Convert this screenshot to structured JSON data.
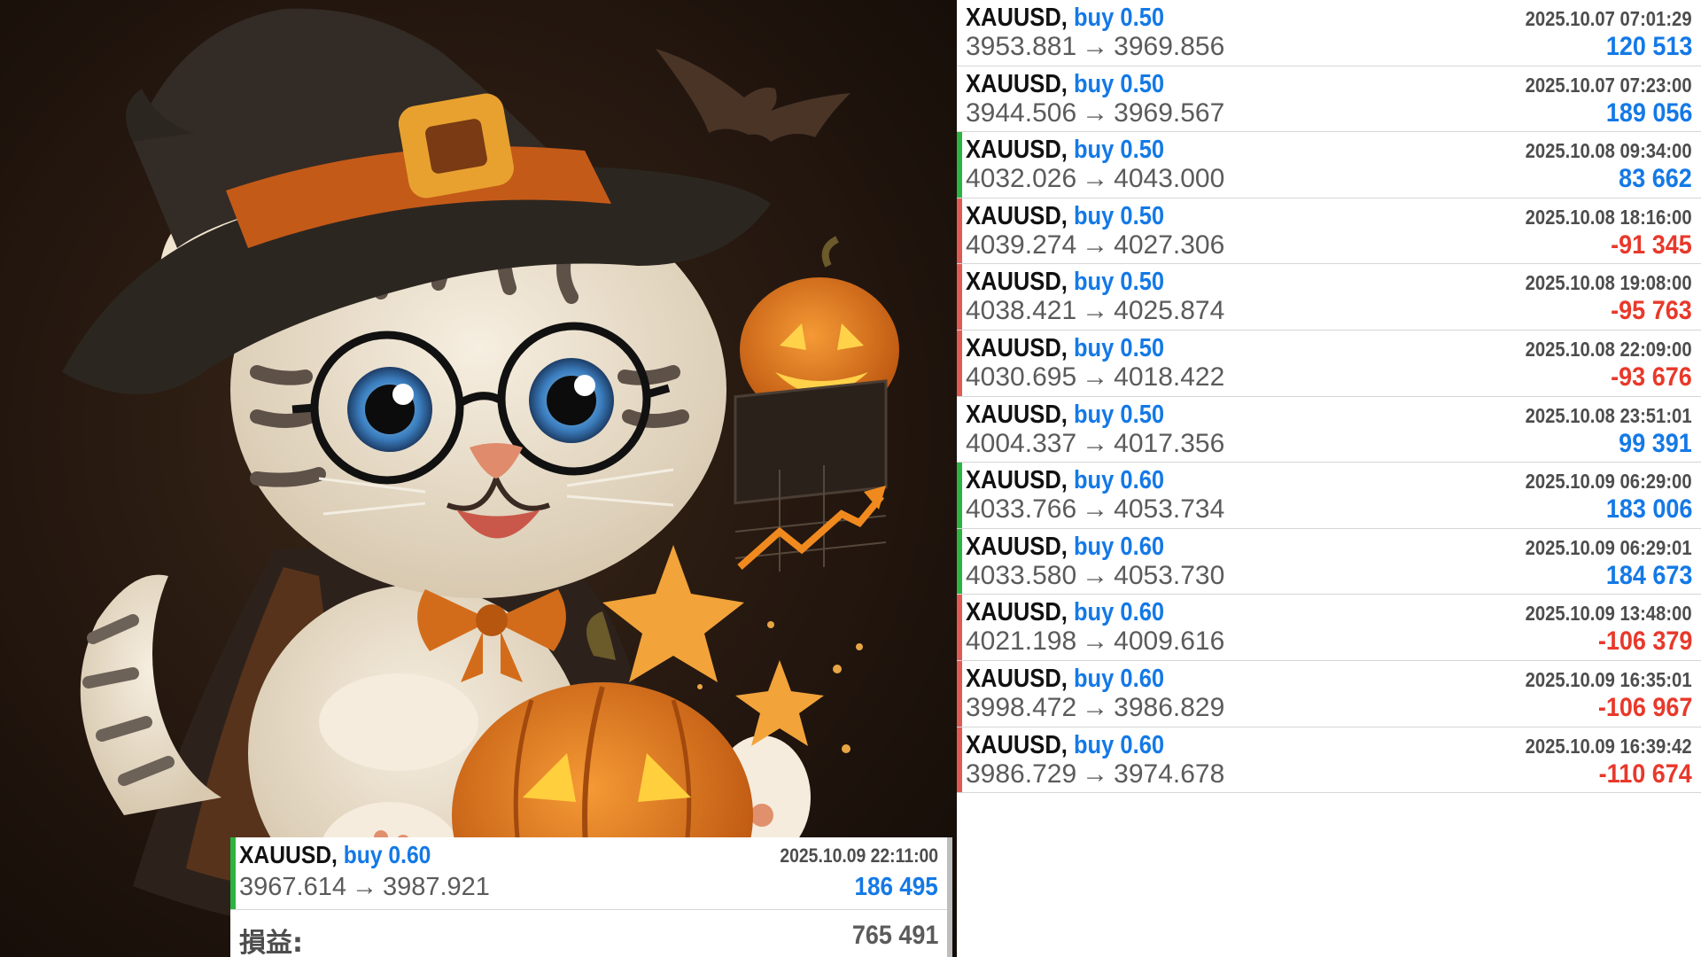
{
  "colors": {
    "buy_text": "#1479e6",
    "profit": "#1479e6",
    "loss": "#e8392b",
    "profit_bar": "#2db341",
    "loss_bar": "#e05a54"
  },
  "illustration": {
    "subject": "kitten-in-witch-hat",
    "icons": [
      "witch-hat-icon",
      "bat-icon",
      "jack-o-lantern-icon",
      "star-icon",
      "chart-arrow-icon"
    ]
  },
  "trades": [
    {
      "symbol": "XAUUSD,",
      "side": "buy 0.50",
      "time": "2025.10.07 07:01:29",
      "open": "3953.881",
      "close": "3969.856",
      "profit": "120 513",
      "result": "none"
    },
    {
      "symbol": "XAUUSD,",
      "side": "buy 0.50",
      "time": "2025.10.07 07:23:00",
      "open": "3944.506",
      "close": "3969.567",
      "profit": "189 056",
      "result": "none"
    },
    {
      "symbol": "XAUUSD,",
      "side": "buy 0.50",
      "time": "2025.10.08 09:34:00",
      "open": "4032.026",
      "close": "4043.000",
      "profit": "83 662",
      "result": "profit"
    },
    {
      "symbol": "XAUUSD,",
      "side": "buy 0.50",
      "time": "2025.10.08 18:16:00",
      "open": "4039.274",
      "close": "4027.306",
      "profit": "-91 345",
      "result": "loss"
    },
    {
      "symbol": "XAUUSD,",
      "side": "buy 0.50",
      "time": "2025.10.08 19:08:00",
      "open": "4038.421",
      "close": "4025.874",
      "profit": "-95 763",
      "result": "loss"
    },
    {
      "symbol": "XAUUSD,",
      "side": "buy 0.50",
      "time": "2025.10.08 22:09:00",
      "open": "4030.695",
      "close": "4018.422",
      "profit": "-93 676",
      "result": "loss"
    },
    {
      "symbol": "XAUUSD,",
      "side": "buy 0.50",
      "time": "2025.10.08 23:51:01",
      "open": "4004.337",
      "close": "4017.356",
      "profit": "99 391",
      "result": "none"
    },
    {
      "symbol": "XAUUSD,",
      "side": "buy 0.60",
      "time": "2025.10.09 06:29:00",
      "open": "4033.766",
      "close": "4053.734",
      "profit": "183 006",
      "result": "profit"
    },
    {
      "symbol": "XAUUSD,",
      "side": "buy 0.60",
      "time": "2025.10.09 06:29:01",
      "open": "4033.580",
      "close": "4053.730",
      "profit": "184 673",
      "result": "profit"
    },
    {
      "symbol": "XAUUSD,",
      "side": "buy 0.60",
      "time": "2025.10.09 13:48:00",
      "open": "4021.198",
      "close": "4009.616",
      "profit": "-106 379",
      "result": "loss"
    },
    {
      "symbol": "XAUUSD,",
      "side": "buy 0.60",
      "time": "2025.10.09 16:35:01",
      "open": "3998.472",
      "close": "3986.829",
      "profit": "-106 967",
      "result": "loss"
    },
    {
      "symbol": "XAUUSD,",
      "side": "buy 0.60",
      "time": "2025.10.09 16:39:42",
      "open": "3986.729",
      "close": "3974.678",
      "profit": "-110 674",
      "result": "loss"
    }
  ],
  "overlay": {
    "trade": {
      "symbol": "XAUUSD,",
      "side": "buy 0.60",
      "time": "2025.10.09 22:11:00",
      "open": "3967.614",
      "close": "3987.921",
      "profit": "186 495",
      "result": "profit"
    },
    "total_label": "損益:",
    "total_value": "765 491"
  },
  "arrow": "→"
}
